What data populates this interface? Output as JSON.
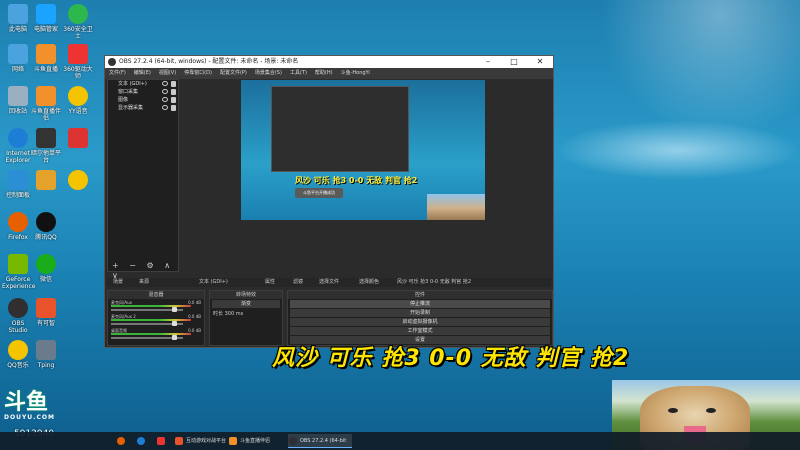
{
  "desktop": {
    "icons": [
      {
        "label": "此电脑",
        "color": "#4aa3df"
      },
      {
        "label": "网络",
        "color": "#4aa3df"
      },
      {
        "label": "回收站",
        "color": "#9ab0c0"
      },
      {
        "label": "Internet Explorer",
        "color": "#1e7ed6"
      },
      {
        "label": "控制面板",
        "color": "#2c8fd6"
      },
      {
        "label": "Firefox",
        "color": "#e66000"
      },
      {
        "label": "GeForce Experience",
        "color": "#76b900"
      },
      {
        "label": "OBS Studio",
        "color": "#302e31"
      },
      {
        "label": "QQ音乐",
        "color": "#f5c400"
      },
      {
        "label": "电脑管家",
        "color": "#1aa3ff"
      },
      {
        "label": "斗鱼直播",
        "color": "#f2902b"
      },
      {
        "label": "斗鱼直播伴侣",
        "color": "#f2902b"
      },
      {
        "label": "暗尔他单平台",
        "color": "#333"
      },
      {
        "label": "",
        "color": "#e5a22b"
      },
      {
        "label": "腾讯QQ",
        "color": "#111"
      },
      {
        "label": "微信",
        "color": "#1aad19"
      },
      {
        "label": "有可智",
        "color": "#e8532b"
      },
      {
        "label": "Tping",
        "color": "#6a7c8c"
      },
      {
        "label": "360安全卫士",
        "color": "#2db84d"
      },
      {
        "label": "360驱动大师",
        "color": "#e33"
      },
      {
        "label": "YY语音",
        "color": "#f5c400"
      },
      {
        "label": "",
        "color": "#d33"
      },
      {
        "label": "",
        "color": "#f5c400"
      }
    ]
  },
  "obs": {
    "title": "OBS 27.2.4 (64-bit, windows) - 配置文件: 未命名 - 场景: 未命名",
    "menu": [
      "文件(F)",
      "编辑(E)",
      "视图(V)",
      "停靠窗口(D)",
      "配置文件(P)",
      "场景集合(S)",
      "工具(T)",
      "帮助(H)",
      "斗鱼-HongYi"
    ],
    "sources": [
      "文本 (GDI+)",
      "窗口采集",
      "图像",
      "显示器采集"
    ],
    "tabs": {
      "scenes": "场景",
      "sources": "来源",
      "text_source": "文本 (GDI+)",
      "properties": "属性",
      "filters": "滤镜",
      "select_file": "选择文件",
      "select_color": "选择颜色",
      "text_value": "风沙 可乐 抢3 0-0 无敌 判官 抢2"
    },
    "mixer": {
      "header": "混音器",
      "tracks": [
        {
          "name": "麦克风/Aux",
          "db": "0.0 dB"
        },
        {
          "name": "麦克风/Aux 2",
          "db": "0.0 dB"
        },
        {
          "name": "桌面音频",
          "db": "0.0 dB"
        }
      ]
    },
    "transitions": {
      "header": "转场特效",
      "fade": "渐变",
      "duration_label": "时长",
      "duration_value": "300 ms"
    },
    "controls": {
      "header": "控件",
      "buttons": [
        "停止推流",
        "开始录制",
        "启动虚拟摄像机",
        "工作室模式",
        "设置",
        "退出"
      ]
    },
    "preview": {
      "caption": "风沙 可乐 抢3 0-0 无敌 判官 抢2",
      "toast": "斗鱼平台开播成功"
    }
  },
  "overlay": {
    "caption": "风沙 可乐 抢3 0-0 无敌 判官 抢2",
    "logo_big": "斗鱼",
    "logo_small": "DOUYU.COM",
    "room_id": "5913940"
  },
  "taskbar": {
    "items": [
      {
        "label": "",
        "color": "#e66000"
      },
      {
        "label": "",
        "color": "#1e7ed6"
      },
      {
        "label": "",
        "color": "#e33"
      },
      {
        "label": "互动游戏对战平台",
        "color": "#e8532b"
      },
      {
        "label": "斗鱼直播伴侣",
        "color": "#f2902b"
      },
      {
        "label": "OBS 27.2.4 (64-bit",
        "color": "#302e31"
      }
    ]
  }
}
